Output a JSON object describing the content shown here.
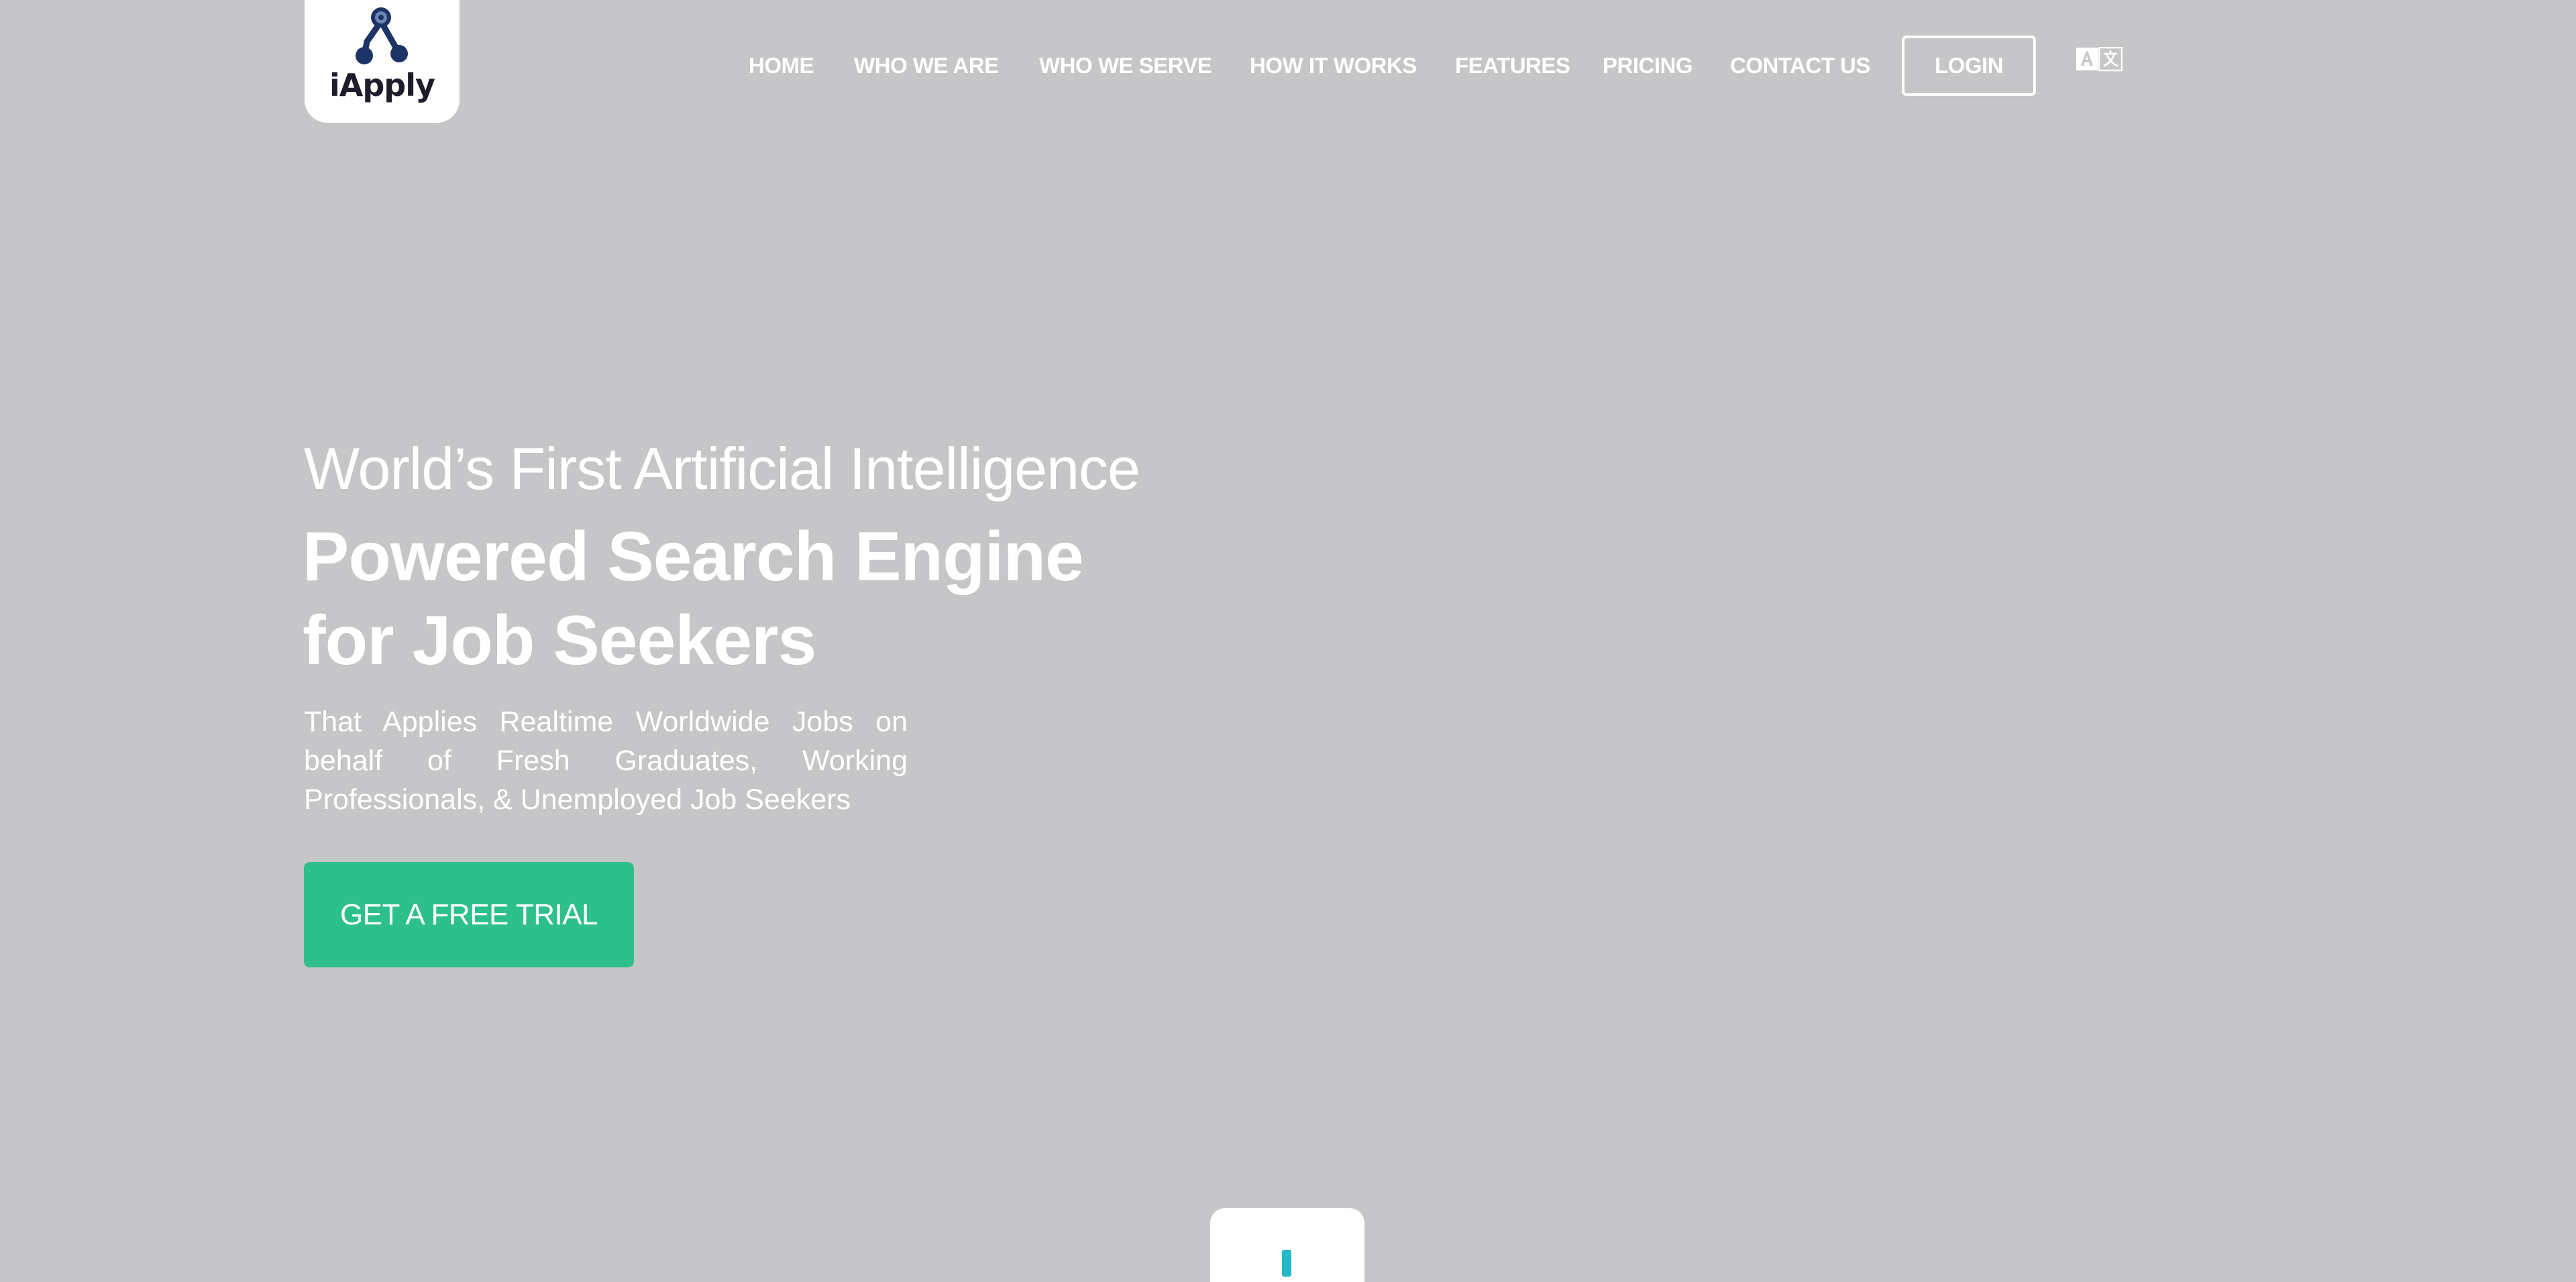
{
  "brand": {
    "name": "iApply",
    "logo_color": "#1c3466"
  },
  "nav": {
    "items": [
      {
        "label": "HOME"
      },
      {
        "label": "WHO WE ARE"
      },
      {
        "label": "WHO WE SERVE"
      },
      {
        "label": "HOW IT WORKS"
      },
      {
        "label": "FEATURES"
      },
      {
        "label": "PRICING"
      },
      {
        "label": "CONTACT US"
      }
    ],
    "login_label": "LOGIN",
    "language_icon": "translate-icon"
  },
  "hero": {
    "line1": "World’s First Artificial Intelligence",
    "title_line1": "Powered Search Engine",
    "title_line2": "for Job Seekers",
    "subtitle": "That Applies Realtime Worldwide Jobs on behalf of Fresh Graduates, Working Professionals, & Unemployed Job Seekers",
    "cta_label": "GET A FREE TRIAL",
    "cta_color": "#2ec08b"
  },
  "colors": {
    "background": "#c6c6c8",
    "text": "#ffffff",
    "accent_teal": "#27b8c8"
  }
}
